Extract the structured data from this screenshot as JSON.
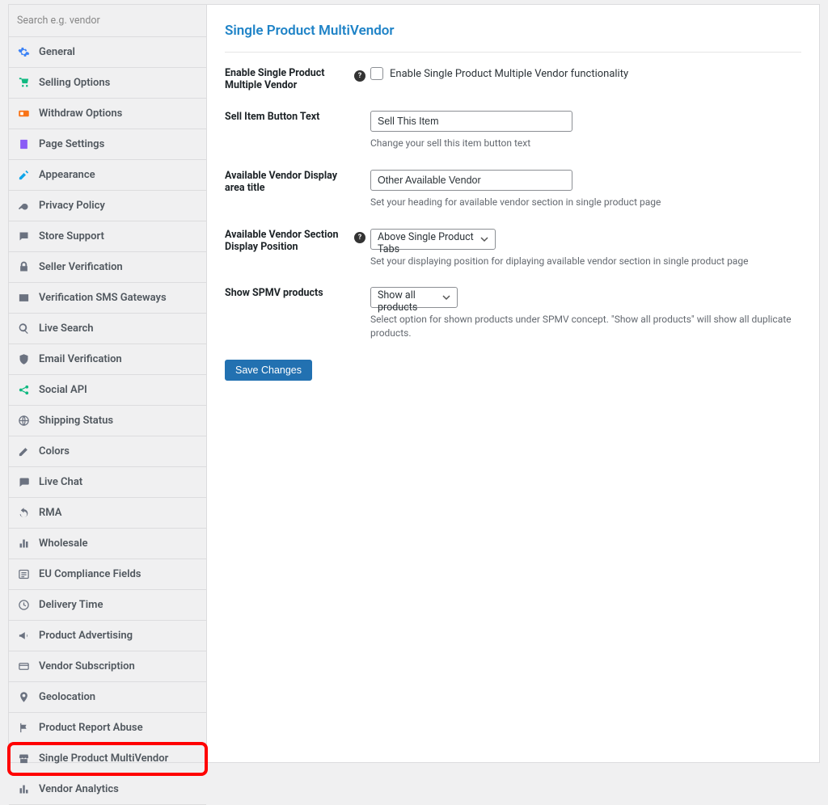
{
  "sidebar": {
    "search_placeholder": "Search e.g. vendor",
    "items": [
      {
        "label": "General",
        "icon": "gear-icon",
        "color": "#3b82f6"
      },
      {
        "label": "Selling Options",
        "icon": "cart-icon",
        "color": "#10b981"
      },
      {
        "label": "Withdraw Options",
        "icon": "withdraw-icon",
        "color": "#f97316"
      },
      {
        "label": "Page Settings",
        "icon": "page-icon",
        "color": "#8b5cf6"
      },
      {
        "label": "Appearance",
        "icon": "brush-icon",
        "color": "#0ea5e9"
      },
      {
        "label": "Privacy Policy",
        "icon": "key-icon",
        "color": "#6b7280"
      },
      {
        "label": "Store Support",
        "icon": "chat-icon",
        "color": "#6b7280"
      },
      {
        "label": "Seller Verification",
        "icon": "lock-icon",
        "color": "#6b7280"
      },
      {
        "label": "Verification SMS Gateways",
        "icon": "envelope-icon",
        "color": "#6b7280"
      },
      {
        "label": "Live Search",
        "icon": "search-icon",
        "color": "#6b7280"
      },
      {
        "label": "Email Verification",
        "icon": "shield-icon",
        "color": "#6b7280"
      },
      {
        "label": "Social API",
        "icon": "share-icon",
        "color": "#10b981"
      },
      {
        "label": "Shipping Status",
        "icon": "globe-icon",
        "color": "#6b7280"
      },
      {
        "label": "Colors",
        "icon": "pencil-icon",
        "color": "#6b7280"
      },
      {
        "label": "Live Chat",
        "icon": "comment-icon",
        "color": "#6b7280"
      },
      {
        "label": "RMA",
        "icon": "undo-icon",
        "color": "#6b7280"
      },
      {
        "label": "Wholesale",
        "icon": "wholesale-icon",
        "color": "#6b7280"
      },
      {
        "label": "EU Compliance Fields",
        "icon": "compliance-icon",
        "color": "#6b7280"
      },
      {
        "label": "Delivery Time",
        "icon": "clock-icon",
        "color": "#6b7280"
      },
      {
        "label": "Product Advertising",
        "icon": "megaphone-icon",
        "color": "#6b7280"
      },
      {
        "label": "Vendor Subscription",
        "icon": "card-icon",
        "color": "#6b7280"
      },
      {
        "label": "Geolocation",
        "icon": "pin-icon",
        "color": "#6b7280"
      },
      {
        "label": "Product Report Abuse",
        "icon": "flag-icon",
        "color": "#6b7280"
      },
      {
        "label": "Single Product MultiVendor",
        "icon": "store-icon",
        "color": "#6b7280",
        "active": true
      },
      {
        "label": "Vendor Analytics",
        "icon": "chart-icon",
        "color": "#6b7280"
      }
    ]
  },
  "page": {
    "title": "Single Product MultiVendor",
    "fields": {
      "enable": {
        "label": "Enable Single Product Multiple Vendor",
        "checkbox_label": "Enable Single Product Multiple Vendor functionality"
      },
      "button_text": {
        "label": "Sell Item Button Text",
        "value": "Sell This Item",
        "help": "Change your sell this item button text"
      },
      "area_title": {
        "label": "Available Vendor Display area title",
        "value": "Other Available Vendor",
        "help": "Set your heading for available vendor section in single product page"
      },
      "display_position": {
        "label": "Available Vendor Section Display Position",
        "value": "Above Single Product Tabs",
        "help": "Set your displaying position for diplaying available vendor section in single product page"
      },
      "show_products": {
        "label": "Show SPMV products",
        "value": "Show all products",
        "help": "Select option for shown products under SPMV concept. \"Show all products\" will show all duplicate products."
      }
    },
    "save_button": "Save Changes"
  }
}
